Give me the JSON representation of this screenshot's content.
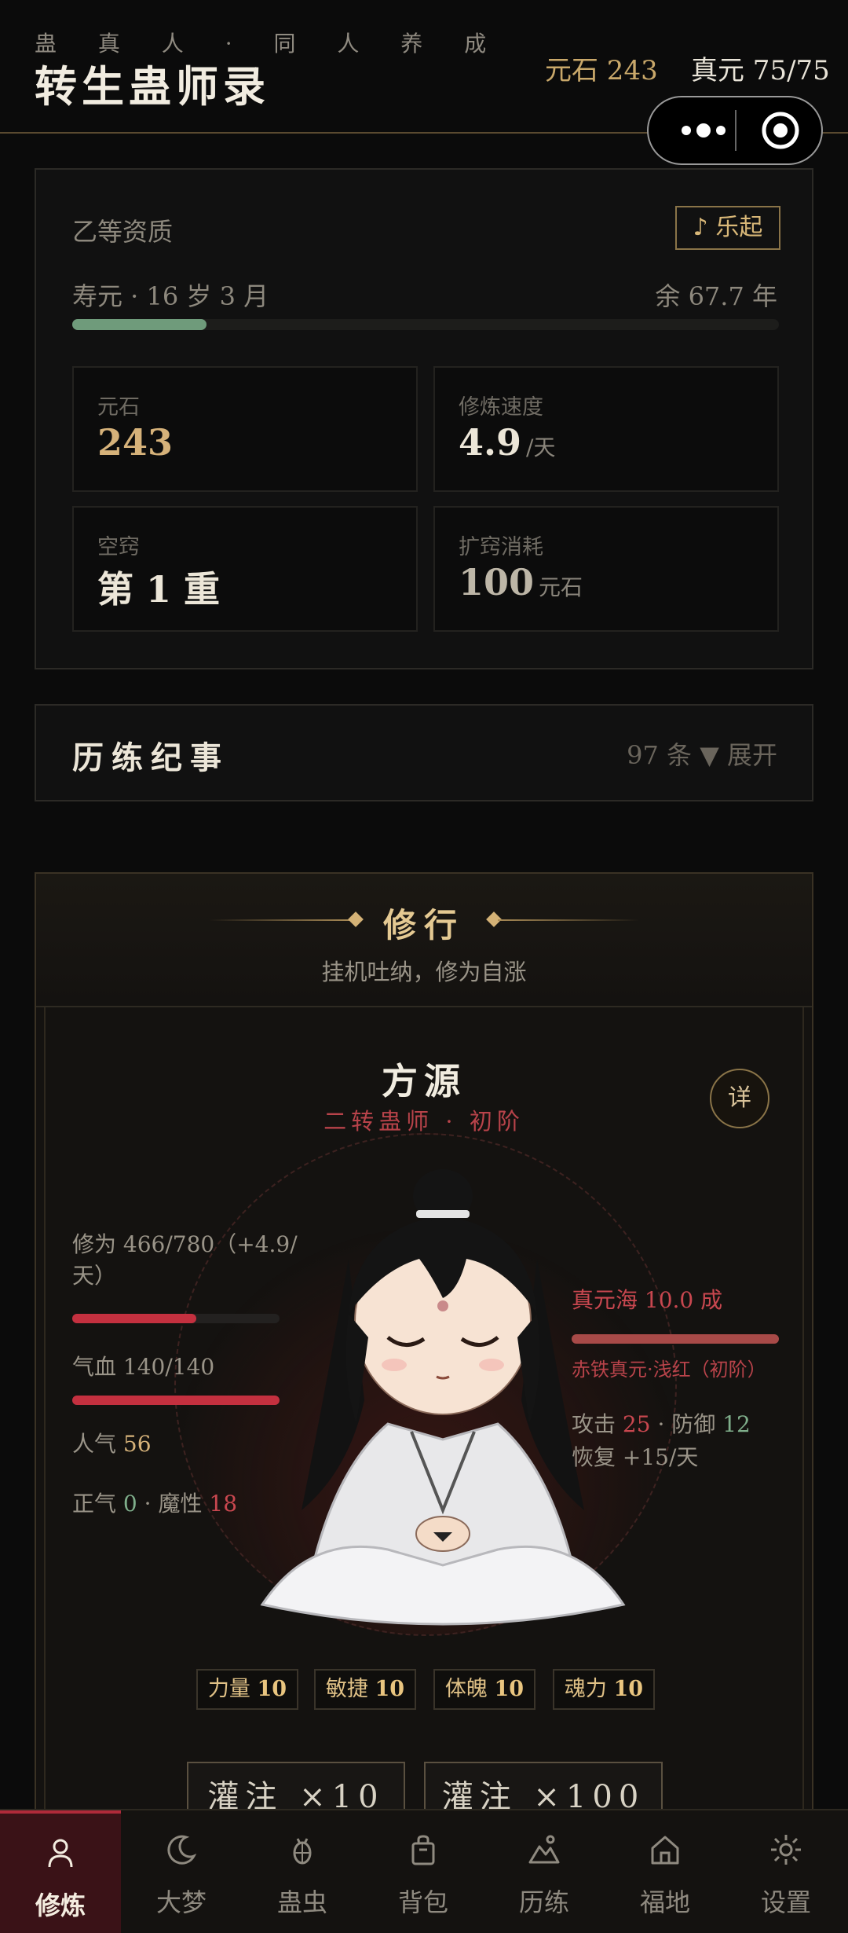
{
  "header": {
    "subtitle": "蛊 真 人 · 同 人 养 成",
    "title": "转生蛊师录",
    "stone_label": "元石 243",
    "qi_label": "真元 75/75"
  },
  "profile": {
    "quality": "乙等资质",
    "music_button": "♪ 乐起",
    "lifespan": "寿元 · 16 岁 3 月",
    "remaining": "余 67.7 年",
    "life_progress": 0.19,
    "stats": [
      {
        "label": "元石",
        "value": "243",
        "unit": ""
      },
      {
        "label": "修炼速度",
        "value": "4.9",
        "unit": "/天"
      },
      {
        "label": "空窍",
        "value": "第 1 重",
        "unit": ""
      },
      {
        "label": "扩窍消耗",
        "value": "100",
        "unit": "元石"
      }
    ]
  },
  "journal": {
    "title": "历练纪事",
    "summary": "97 条 ▼ 展开"
  },
  "cultivation": {
    "title": "修行",
    "subtitle": "挂机吐纳，修为自涨",
    "hero_name": "方源",
    "hero_rank": "二转蛊师 · 初阶",
    "detail_button": "详",
    "cultivation_text": "修为 466/780（+4.9/天）",
    "cultivation_progress": 0.597,
    "hp_text": "气血 140/140",
    "hp_progress": 1.0,
    "popularity_label": "人气",
    "popularity_value": "56",
    "righteous_label": "正气",
    "righteous_value": "0",
    "demonic_label": "魔性",
    "demonic_value": "18",
    "sea_text": "真元海 10.0 成",
    "sea_progress": 1.0,
    "essence_type": "赤铁真元·浅红（初阶）",
    "attack_label": "攻击",
    "attack_value": "25",
    "defense_label": "防御",
    "defense_value": "12",
    "recover_text": "恢复 +15/天",
    "attributes": [
      {
        "name": "力量",
        "value": "10"
      },
      {
        "name": "敏捷",
        "value": "10"
      },
      {
        "name": "体魄",
        "value": "10"
      },
      {
        "name": "魂力",
        "value": "10"
      }
    ],
    "pour_buttons": [
      "灌注 ×10",
      "灌注 ×100"
    ]
  },
  "tabs": [
    {
      "label": "修炼",
      "icon": "person-icon"
    },
    {
      "label": "大梦",
      "icon": "moon-icon"
    },
    {
      "label": "蛊虫",
      "icon": "bug-icon"
    },
    {
      "label": "背包",
      "icon": "bag-icon"
    },
    {
      "label": "历练",
      "icon": "mountain-icon"
    },
    {
      "label": "福地",
      "icon": "home-icon"
    },
    {
      "label": "设置",
      "icon": "gear-icon"
    }
  ],
  "colors": {
    "gold": "#d6b27a",
    "red": "#c8474f",
    "green": "#7fae8b",
    "active_tab": "#3a1217"
  }
}
